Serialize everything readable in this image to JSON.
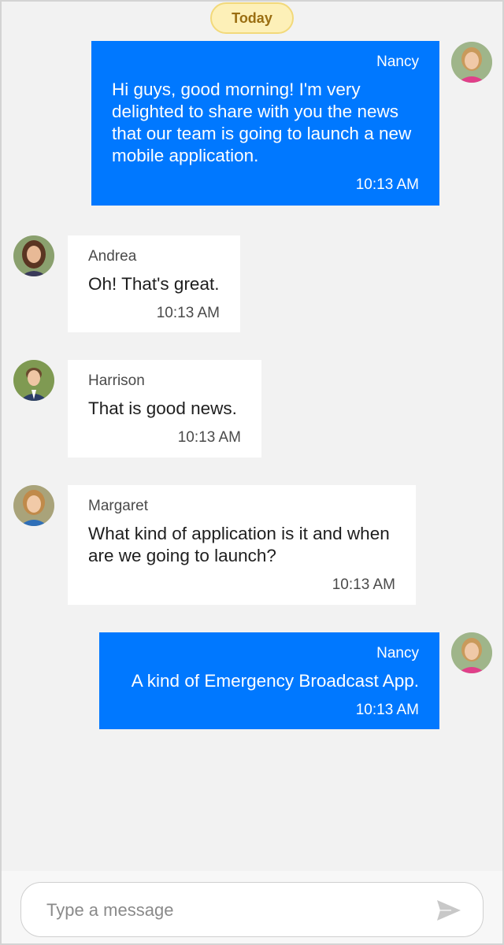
{
  "date_separator": "Today",
  "colors": {
    "outgoing_bubble": "#0078ff",
    "incoming_bubble": "#ffffff",
    "background": "#f2f2f2",
    "date_pill": "#fdf0b8"
  },
  "messages": [
    {
      "sender": "Nancy",
      "direction": "outgoing",
      "text": "Hi guys, good morning! I'm very delighted to share with you the news that our team is going to launch a new mobile application.",
      "time": "10:13 AM"
    },
    {
      "sender": "Andrea",
      "direction": "incoming",
      "text": "Oh! That's great.",
      "time": "10:13 AM"
    },
    {
      "sender": "Harrison",
      "direction": "incoming",
      "text": "That is good news.",
      "time": "10:13 AM"
    },
    {
      "sender": "Margaret",
      "direction": "incoming",
      "text": "What kind of application is it and when are we going to launch?",
      "time": "10:13 AM"
    },
    {
      "sender": "Nancy",
      "direction": "outgoing",
      "text": "A kind of Emergency Broadcast App.",
      "time": "10:13 AM"
    }
  ],
  "composer": {
    "placeholder": "Type a message",
    "value": "",
    "send_icon": "send-icon"
  }
}
